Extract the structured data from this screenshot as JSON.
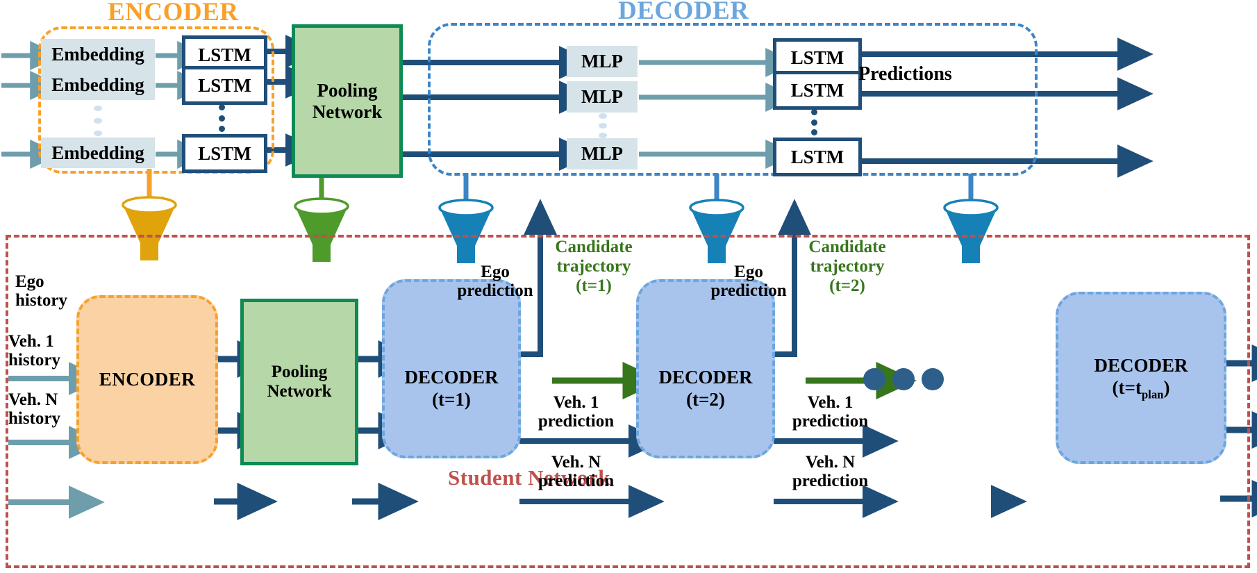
{
  "headings": {
    "encoder": "ENCODER",
    "decoder": "DECODER",
    "student": "Student Network"
  },
  "teacher": {
    "embedding_label": "Embedding",
    "lstm_label": "LSTM",
    "mlp_label": "MLP",
    "pooling_label": "Pooling\nNetwork",
    "pooling_line1": "Pooling",
    "pooling_line2": "Network",
    "predictions_label": "Predictions",
    "rows": [
      {
        "embedding": "Embedding",
        "lstm": "LSTM",
        "mlp": "MLP",
        "lstm_out": "LSTM"
      },
      {
        "embedding": "Embedding",
        "lstm": "LSTM",
        "mlp": "MLP",
        "lstm_out": "LSTM"
      },
      {
        "embedding": "Embedding",
        "lstm": "LSTM",
        "mlp": "MLP",
        "lstm_out": "LSTM"
      }
    ]
  },
  "funnels": [
    {
      "name": "encoder-funnel",
      "color": "#E0A30C"
    },
    {
      "name": "pooling-funnel",
      "color": "#4E9A2A"
    },
    {
      "name": "decoder-funnel-1",
      "color": "#1681B7"
    },
    {
      "name": "decoder-funnel-2",
      "color": "#1681B7"
    },
    {
      "name": "decoder-funnel-3",
      "color": "#1681B7"
    }
  ],
  "student": {
    "inputs": [
      {
        "line1": "Ego",
        "line2": "history"
      },
      {
        "line1": "Veh. 1",
        "line2": "history"
      },
      {
        "line1": "Veh. N",
        "line2": "history"
      }
    ],
    "encoder_label": "ENCODER",
    "pooling_line1": "Pooling",
    "pooling_line2": "Network",
    "decoders": [
      {
        "name": "DECODER",
        "time": "(t=1)"
      },
      {
        "name": "DECODER",
        "time": "(t=2)"
      },
      {
        "name": "DECODER",
        "time_prefix": "(t=t",
        "time_sub": "plan",
        "time_suffix": ")"
      }
    ],
    "ego_prediction_line1": "Ego",
    "ego_prediction_line2": "prediction",
    "candidates": [
      {
        "line1": "Candidate",
        "line2": "trajectory",
        "line3": "(t=1)"
      },
      {
        "line1": "Candidate",
        "line2": "trajectory",
        "line3": "(t=2)"
      }
    ],
    "veh1_line1": "Veh. 1",
    "veh1_line2": "prediction",
    "vehN_line1": "Veh. N",
    "vehN_line2": "prediction"
  },
  "colors": {
    "orange": "#F7A12C",
    "light_blue": "#6CA6DE",
    "dark_blue": "#1F4E79",
    "teal_arrow": "#6E9EAB",
    "green_border": "#0E8A55",
    "green_fill": "#B6D7A8",
    "green_arrow": "#38761D",
    "red_dashdot": "#C0504D",
    "embed_fill": "#D6E3E8",
    "student_encoder_fill": "#FAD2A4",
    "student_decoder_fill": "#A9C4EC",
    "funnel_blue": "#1681B7",
    "funnel_yellow": "#E0A30C",
    "funnel_green": "#4E9A2A"
  }
}
